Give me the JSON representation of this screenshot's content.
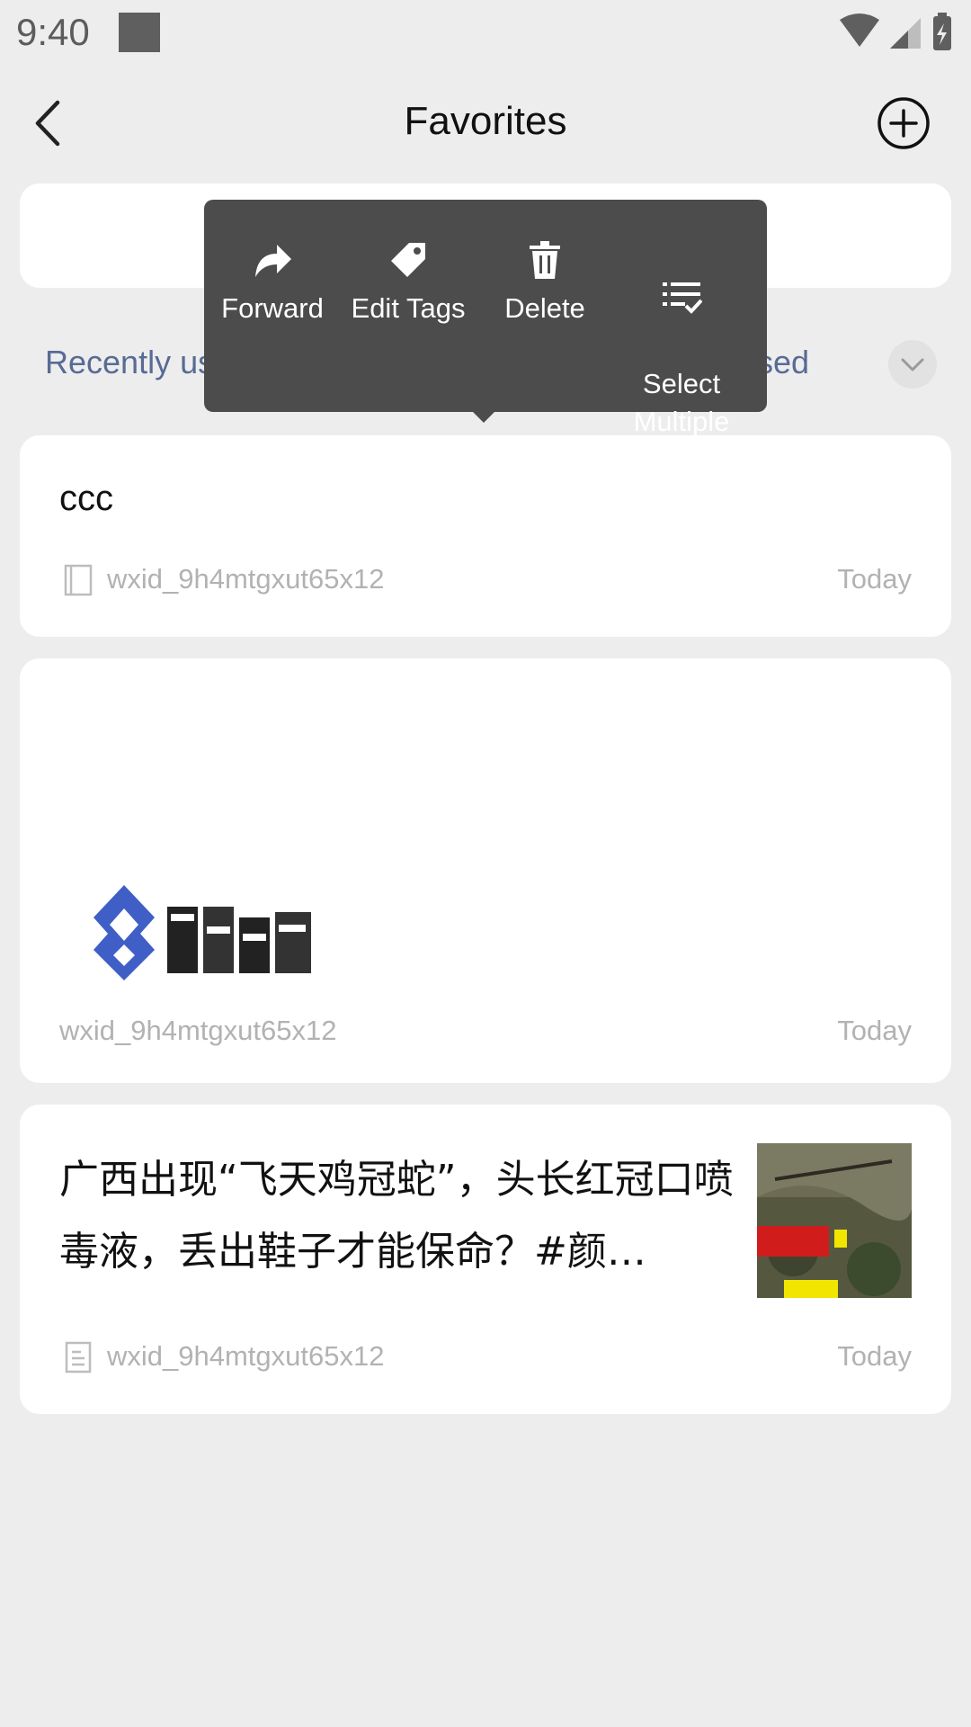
{
  "status_bar": {
    "time": "9:40"
  },
  "header": {
    "title": "Favorites"
  },
  "filter": {
    "left_label": "Recently us",
    "right_label": "sed"
  },
  "popup_menu": {
    "items": [
      {
        "label": "Forward"
      },
      {
        "label": "Edit Tags"
      },
      {
        "label": "Delete"
      },
      {
        "label": "Select\nMultiple"
      }
    ]
  },
  "items": [
    {
      "title": "ccc",
      "source": "wxid_9h4mtgxut65x12",
      "date": "Today"
    },
    {
      "source": "wxid_9h4mtgxut65x12",
      "date": "Today"
    },
    {
      "title": "广西出现“飞天鸡冠蛇”，头长红冠口喷毒液，丢出鞋子才能保命？#颜…",
      "source": "wxid_9h4mtgxut65x12",
      "date": "Today"
    }
  ]
}
